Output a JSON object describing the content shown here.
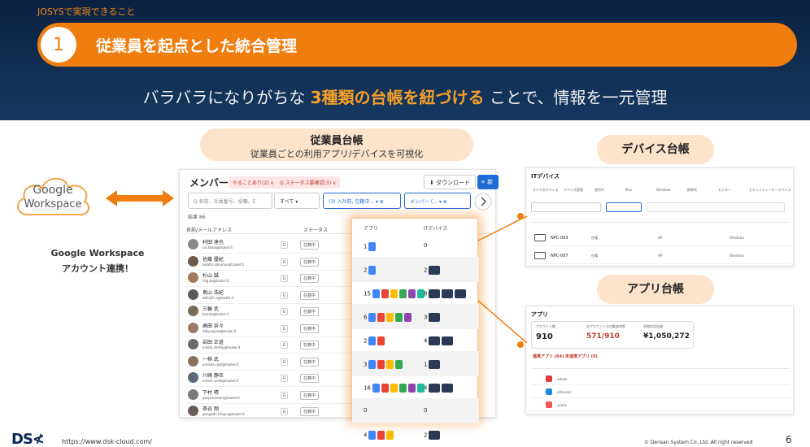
{
  "header": {
    "kicker": "JOSYSで実現できること",
    "number": "1",
    "title": "従業員を起点とした統合管理",
    "sub_pre": "バラバラになりがちな ",
    "sub_highlight": "3種類の台帳を紐づける",
    "sub_post": " ことで、情報を一元管理"
  },
  "google": {
    "logo_word": "Google",
    "logo_sub": "Workspace",
    "label_line1": "Google Workspace",
    "label_line2": "アカウント連携！"
  },
  "employee_ledger": {
    "title": "従業員台帳",
    "subtitle": "従業員ごとの利用アプリ/デバイスを可視化",
    "panel_title": "メンバー",
    "chip1": "やることあり(2) ∨",
    "chip2": "G ステータス要確認(3) ∨",
    "download": "⬇ ダウンロード",
    "add": "+ 新",
    "search_placeholder": "Q 名前、社員番号、役職、E",
    "filter_all": "すべて ▾",
    "filter_status": "(3) 入社前, 在籍中... ▾ ⊗",
    "filter_member": "メンバー (... ▾ ⊗",
    "count": "結果 86",
    "col_name": "名前/メールアドレス",
    "col_status": "ステータス",
    "col_app": "アプリ",
    "col_device": "ITデバイス",
    "rows": [
      {
        "name": "村田 達也",
        "email": "sai.tbala@tsukel.it",
        "status": "在籍中",
        "app": "1",
        "device": "0"
      },
      {
        "name": "佐藤 優紀",
        "email": "swathi.valumas@tsukel.it",
        "status": "在籍中",
        "app": "2",
        "device": "2"
      },
      {
        "name": "杉山 誠",
        "email": "f.hg.ta@tsukel.it",
        "status": "在籍中",
        "app": "15",
        "device": "8"
      },
      {
        "name": "島山 浩紀",
        "email": "abhijith.s@tsukel.it",
        "status": "在籍中",
        "app": "6",
        "device": "3"
      },
      {
        "name": "三輪 武",
        "email": "jtzumi@tsukel.it",
        "status": "在籍中",
        "app": "2",
        "device": "4"
      },
      {
        "name": "高田 奈々",
        "email": "elby.payne@tsukel.it",
        "status": "在籍中",
        "app": "3",
        "device": "1"
      },
      {
        "name": "岩田 正道",
        "email": "ankita.shetty@tsukel.it",
        "status": "在籍中",
        "app": "16",
        "device": "4"
      },
      {
        "name": "一柳 武",
        "email": "anusha.rapt@tsukel.it",
        "status": "在籍中",
        "app": "0",
        "device": "0"
      },
      {
        "name": "川崎 静衣",
        "email": "ashish.virde@tsukel.it",
        "status": "在籍中",
        "app": "",
        "device": ""
      },
      {
        "name": "下村 晴",
        "email": "pooja.kumari@tsukel.it",
        "status": "在籍中",
        "app": "",
        "device": ""
      },
      {
        "name": "茶谷 剛",
        "email": "gangadri.bingra@tsukel.it",
        "status": "在籍中",
        "app": "4",
        "device": "2"
      }
    ]
  },
  "device_ledger": {
    "title": "デバイス台帳",
    "panel_title": "ITデバイス",
    "tabs": [
      "すべてのデバイス",
      "デバイス管理",
      "使用中",
      "Mac",
      "Windows",
      "携帯系",
      "モニター",
      "セキュリティーキーデバイス"
    ],
    "rows": [
      "NPC-003",
      "NPC-007"
    ],
    "status": "在籍",
    "maker": "HP",
    "os": "Windows"
  },
  "app_ledger": {
    "title": "アプリ台帳",
    "panel_title": "アプリ",
    "metric1_label": "アカウント数",
    "metric1_value": "910",
    "metric2_label": "全アカウントの内勤務状態",
    "metric2_value": "571/910",
    "metric3_label": "年間利用金額",
    "metric3_value": "¥1,050,272",
    "tab": "連携アプリ (64)  未連携アプリ (0)",
    "apps": [
      "adobe",
      "atlassian",
      "asana"
    ]
  },
  "footer": {
    "logo": "DS≮",
    "url": "https://www.dsk-cloud.com/",
    "copyright": "© Densan System Co.,Ltd. All right reserved",
    "page": "6"
  },
  "colors": {
    "accent": "#ef7e0e",
    "navy": "#0c2140",
    "peach": "#fbe3cc"
  }
}
